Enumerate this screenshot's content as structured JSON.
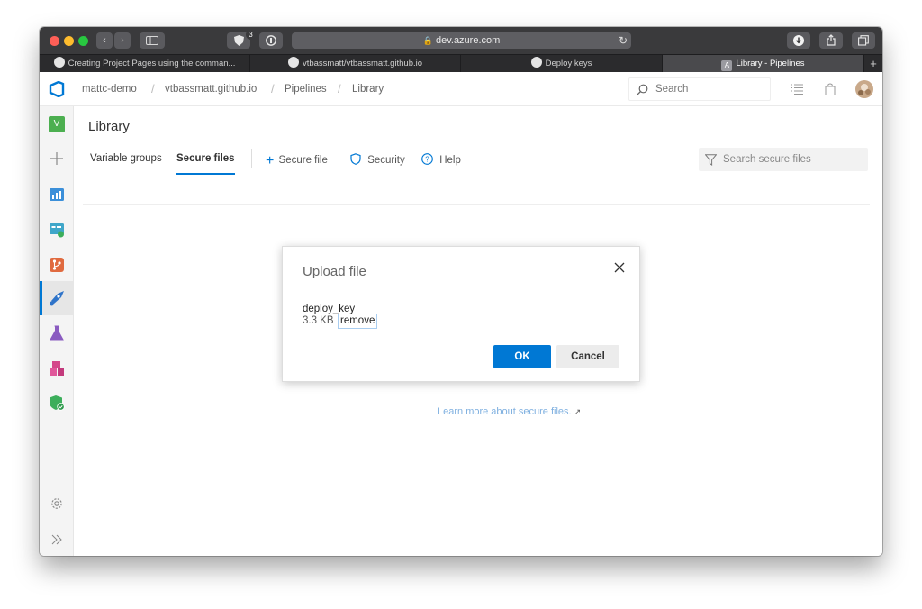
{
  "browser": {
    "tab_count_badge": "3",
    "url": "dev.azure.com",
    "tabs": [
      {
        "label": "Creating Project Pages using the comman..."
      },
      {
        "label": "vtbassmatt/vtbassmatt.github.io"
      },
      {
        "label": "Deploy keys"
      },
      {
        "label": "Library - Pipelines",
        "icon_letter": "A"
      }
    ]
  },
  "header": {
    "breadcrumbs": [
      "mattc-demo",
      "vtbassmatt.github.io",
      "Pipelines",
      "Library"
    ],
    "search_placeholder": "Search"
  },
  "leftnav": {
    "org_initial": "V",
    "colors": {
      "org": "#4caf50",
      "boards": "#3b8fd9",
      "repos": "#e06a3f",
      "pipelines": "#2f74c9",
      "testplans": "#8a5bc0",
      "artifacts": "#d4478a",
      "security": "#3cae5b"
    }
  },
  "page": {
    "title": "Library",
    "tabs": [
      "Variable groups",
      "Secure files"
    ],
    "commands": {
      "add": "Secure file",
      "security": "Security",
      "help": "Help"
    },
    "filter_placeholder": "Search secure files",
    "learn_more": "Learn more about secure files."
  },
  "dialog": {
    "title": "Upload file",
    "file_name": "deploy_key",
    "file_size": "3.3 KB",
    "remove_label": "remove",
    "ok_label": "OK",
    "cancel_label": "Cancel"
  },
  "colors": {
    "accent": "#0078d4",
    "titlebar": "#3a3a3c"
  }
}
